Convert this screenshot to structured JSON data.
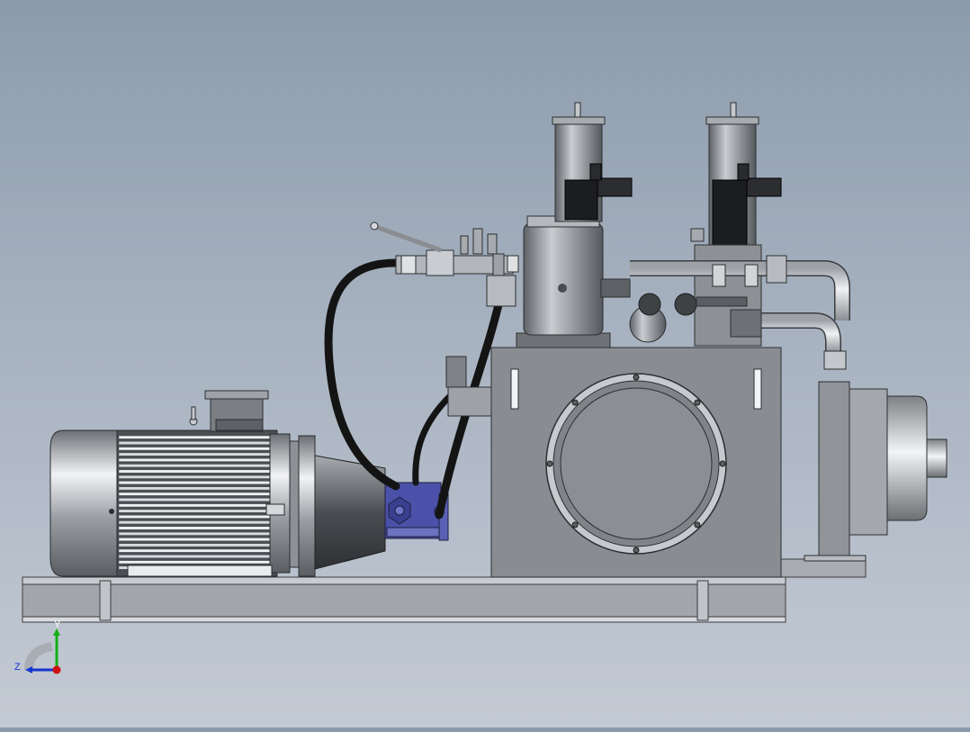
{
  "viewport": {
    "description_name": "graphics-area"
  },
  "triad": {
    "y_label": "Y",
    "z_label": "Z",
    "x_color": "#d01010",
    "y_color": "#10b010",
    "z_color": "#1030d0"
  },
  "colors": {
    "background_top": "#8c9bab",
    "background_bottom": "#c3cad4",
    "tank": "#8a8d90",
    "pump": "#4a4fa0",
    "hose": "#1a1a1a",
    "steel": "#b9bcc0"
  }
}
